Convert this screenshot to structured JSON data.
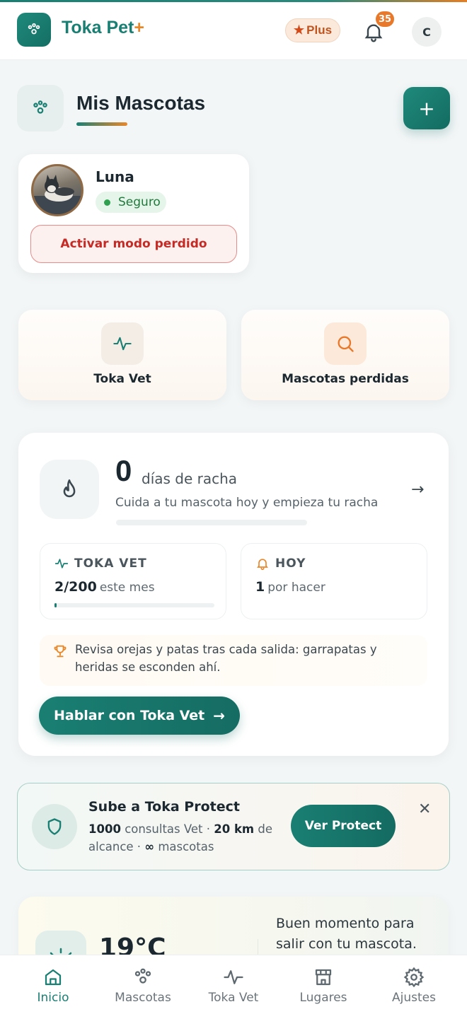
{
  "header": {
    "brand": "Toka Pet",
    "brand_plus": "+",
    "plan_badge": "Plus",
    "notification_count": "35",
    "user_initial": "C"
  },
  "page": {
    "title": "Mis Mascotas",
    "add_label": "+"
  },
  "pet": {
    "name": "Luna",
    "status": "Seguro",
    "lost_mode_button": "Activar modo perdido"
  },
  "quick_actions": [
    {
      "label": "Toka Vet",
      "icon": "pulse-icon"
    },
    {
      "label": "Mascotas perdidas",
      "icon": "search-icon"
    }
  ],
  "streak": {
    "days": "0",
    "label": "días de racha",
    "subtitle": "Cuida a tu mascota hoy y empieza tu racha",
    "progress": 0,
    "vet": {
      "title": "TOKA VET",
      "used": "2/200",
      "period": "este mes",
      "progress": 0.01
    },
    "today": {
      "title": "HOY",
      "count": "1",
      "label": "por hacer"
    },
    "tip": "Revisa orejas y patas tras cada salida: garrapatas y heridas se esconden ahí.",
    "cta": "Hablar con Toka Vet"
  },
  "promo": {
    "title": "Sube a Toka Protect",
    "consults_num": "1000",
    "consults_label": "consultas Vet ·",
    "range_num": "20 km",
    "range_label": "de alcance ·",
    "pets_num": "∞",
    "pets_label": "mascotas",
    "cta": "Ver Protect"
  },
  "weather": {
    "temperature": "19°C",
    "message": "Buen momento para salir con tu mascota."
  },
  "nav": [
    {
      "label": "Inicio",
      "active": true
    },
    {
      "label": "Mascotas",
      "active": false
    },
    {
      "label": "Toka Vet",
      "active": false
    },
    {
      "label": "Lugares",
      "active": false
    },
    {
      "label": "Ajustes",
      "active": false
    }
  ],
  "colors": {
    "primary": "#1a7f73",
    "accent": "#e8872a",
    "danger": "#c52a24",
    "success": "#2ea050"
  }
}
